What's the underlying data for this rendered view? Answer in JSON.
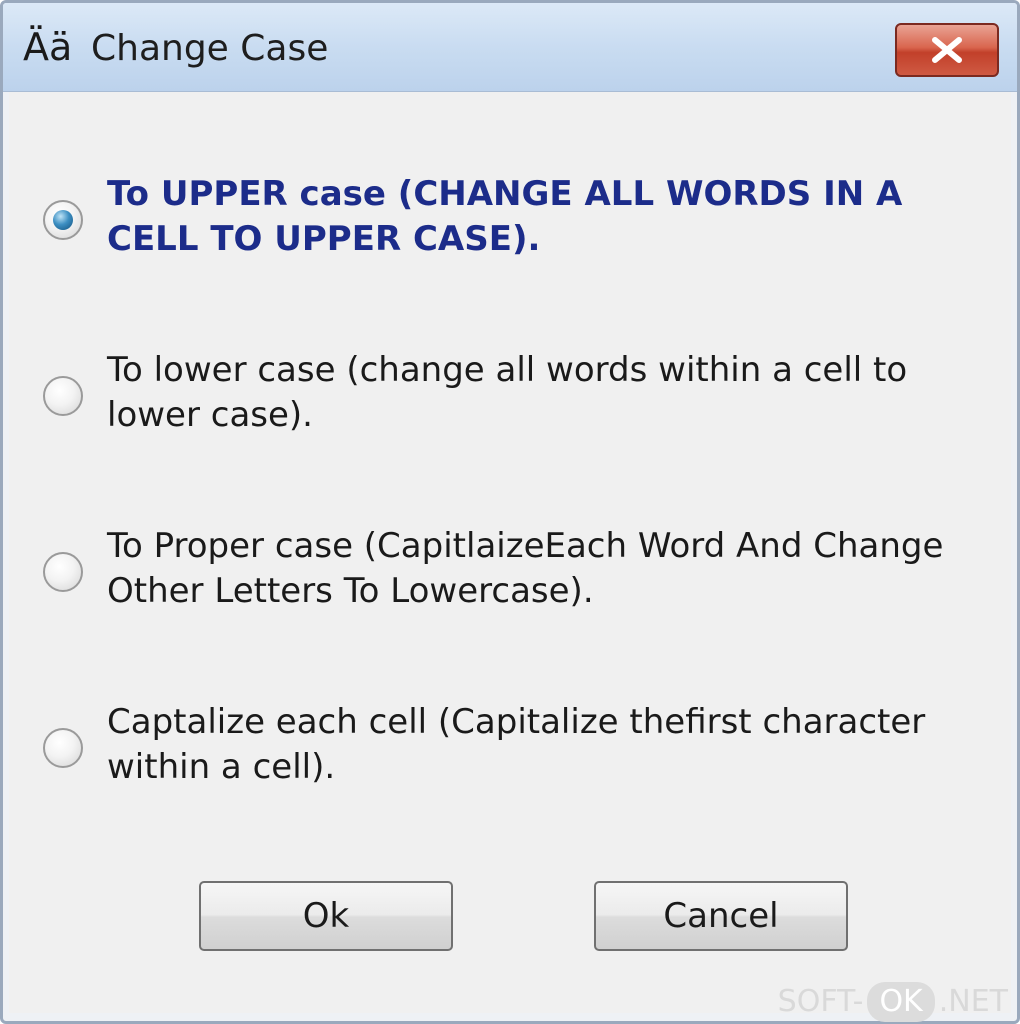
{
  "window": {
    "title": "Change Case",
    "title_icon": "Ää",
    "close_icon": "close-icon"
  },
  "options": [
    {
      "label": "To UPPER case (CHANGE ALL WORDS IN A CELL TO UPPER CASE).",
      "selected": true
    },
    {
      "label": "To lower case (change all words within a cell to lower case).",
      "selected": false
    },
    {
      "label": "To Proper case (CapitlaizeEach Word And Change Other Letters To Lowercase).",
      "selected": false
    },
    {
      "label": "Captalize each cell (Capitalize thefirst character within a cell).",
      "selected": false
    }
  ],
  "buttons": {
    "ok_label": "Ok",
    "cancel_label": "Cancel"
  },
  "watermark": {
    "prefix": "SOFT-",
    "highlight": "OK",
    "suffix": ".NET"
  },
  "colors": {
    "selected_label": "#1c2c8a",
    "radio_selected": "#3d8fc2",
    "close_button": "#c2402a"
  }
}
